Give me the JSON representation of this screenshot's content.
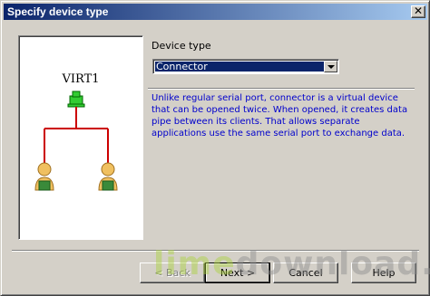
{
  "window": {
    "title": "Specify device type",
    "close_label": "✕"
  },
  "diagram": {
    "device_name": "VIRT1",
    "connector_color": "#33cc33",
    "line_color": "#cc0000"
  },
  "form": {
    "device_type_label": "Device type",
    "device_type_value": "Connector"
  },
  "description": "Unlike regular serial port, connector is a virtual device that can be opened twice. When opened, it creates data pipe between its clients. That allows separate applications use the same serial port to exchange data.",
  "buttons": {
    "back": "< Back",
    "next": "Next >",
    "cancel": "Cancel",
    "help": "Help"
  },
  "watermark": {
    "part1": "lime",
    "part2": "download.com"
  }
}
